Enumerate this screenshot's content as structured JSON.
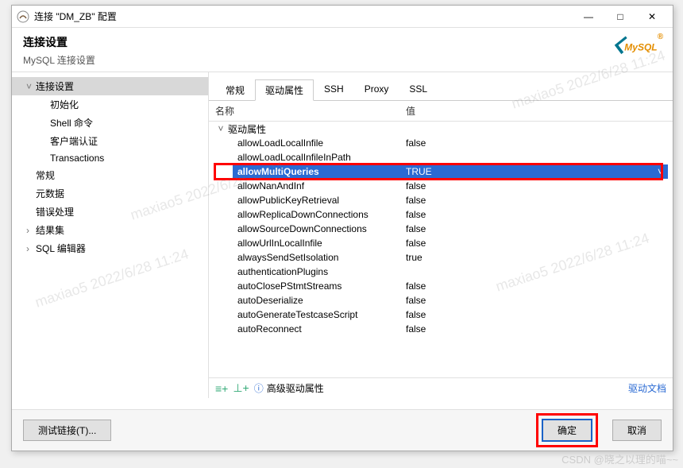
{
  "window": {
    "title": "连接 \"DM_ZB\" 配置",
    "minimize": "—",
    "maximize": "□",
    "close": "✕"
  },
  "header": {
    "title": "连接设置",
    "subtitle": "MySQL 连接设置",
    "logo": "MySQL"
  },
  "sidebar": {
    "items": [
      {
        "label": "连接设置",
        "level": 1,
        "expandable": true,
        "expanded": true,
        "selected": true
      },
      {
        "label": "初始化",
        "level": 2
      },
      {
        "label": "Shell 命令",
        "level": 2
      },
      {
        "label": "客户端认证",
        "level": 2
      },
      {
        "label": "Transactions",
        "level": 2
      },
      {
        "label": "常规",
        "level": 1
      },
      {
        "label": "元数据",
        "level": 1
      },
      {
        "label": "错误处理",
        "level": 1
      },
      {
        "label": "结果集",
        "level": 1,
        "expandable": true,
        "expanded": false
      },
      {
        "label": "SQL 编辑器",
        "level": 1,
        "expandable": true,
        "expanded": false
      }
    ]
  },
  "tabs": {
    "items": [
      "常规",
      "驱动属性",
      "SSH",
      "Proxy",
      "SSL"
    ],
    "active": 1
  },
  "grid": {
    "col_name": "名称",
    "col_value": "值",
    "root": "驱动属性",
    "highlighted": {
      "name": "allowMultiQueries",
      "value": "TRUE"
    },
    "props": [
      {
        "name": "allowLoadLocalInfile",
        "value": "false"
      },
      {
        "name": "allowLoadLocalInfileInPath",
        "value": ""
      },
      {
        "name": "allowMultiQueries",
        "value": "TRUE",
        "hl": true
      },
      {
        "name": "allowNanAndInf",
        "value": "false"
      },
      {
        "name": "allowPublicKeyRetrieval",
        "value": "false"
      },
      {
        "name": "allowReplicaDownConnections",
        "value": "false"
      },
      {
        "name": "allowSourceDownConnections",
        "value": "false"
      },
      {
        "name": "allowUrlInLocalInfile",
        "value": "false"
      },
      {
        "name": "alwaysSendSetIsolation",
        "value": "true"
      },
      {
        "name": "authenticationPlugins",
        "value": ""
      },
      {
        "name": "autoClosePStmtStreams",
        "value": "false"
      },
      {
        "name": "autoDeserialize",
        "value": "false"
      },
      {
        "name": "autoGenerateTestcaseScript",
        "value": "false"
      },
      {
        "name": "autoReconnect",
        "value": "false"
      }
    ]
  },
  "toolbar": {
    "add_icon": "≡+",
    "add_icon2": "⊥+",
    "info_icon": "ⓘ",
    "advanced": "高级驱动属性",
    "docs_link": "驱动文档"
  },
  "footer": {
    "test": "测试链接(T)...",
    "ok": "确定",
    "cancel": "取消"
  },
  "watermark": "maxiao5 2022/6/28 11:24",
  "csdn": "CSDN @晓之以理的喵~~"
}
